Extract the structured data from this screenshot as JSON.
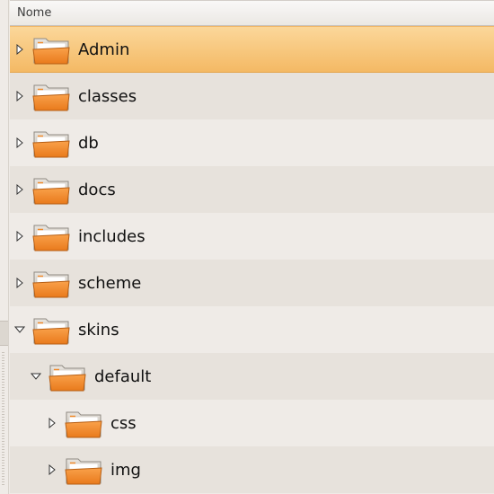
{
  "tree": {
    "column_header": "Nome",
    "rows": [
      {
        "label": "Admin",
        "expanded": false,
        "selected": true,
        "depth": 0
      },
      {
        "label": "classes",
        "expanded": false,
        "selected": false,
        "depth": 0
      },
      {
        "label": "db",
        "expanded": false,
        "selected": false,
        "depth": 0
      },
      {
        "label": "docs",
        "expanded": false,
        "selected": false,
        "depth": 0
      },
      {
        "label": "includes",
        "expanded": false,
        "selected": false,
        "depth": 0
      },
      {
        "label": "scheme",
        "expanded": false,
        "selected": false,
        "depth": 0
      },
      {
        "label": "skins",
        "expanded": true,
        "selected": false,
        "depth": 0
      },
      {
        "label": "default",
        "expanded": true,
        "selected": false,
        "depth": 1
      },
      {
        "label": "css",
        "expanded": false,
        "selected": false,
        "depth": 2
      },
      {
        "label": "img",
        "expanded": false,
        "selected": false,
        "depth": 2
      }
    ]
  },
  "icons": {
    "folder": "folder-icon",
    "collapsed": "triangle-right-icon",
    "expanded": "triangle-down-icon"
  },
  "colors": {
    "selection_top": "#fbd79a",
    "selection_bottom": "#f4b964",
    "folder_orange": "#f08a2a",
    "row_alt": "#e7e2dc",
    "row_plain": "#efebe7"
  }
}
